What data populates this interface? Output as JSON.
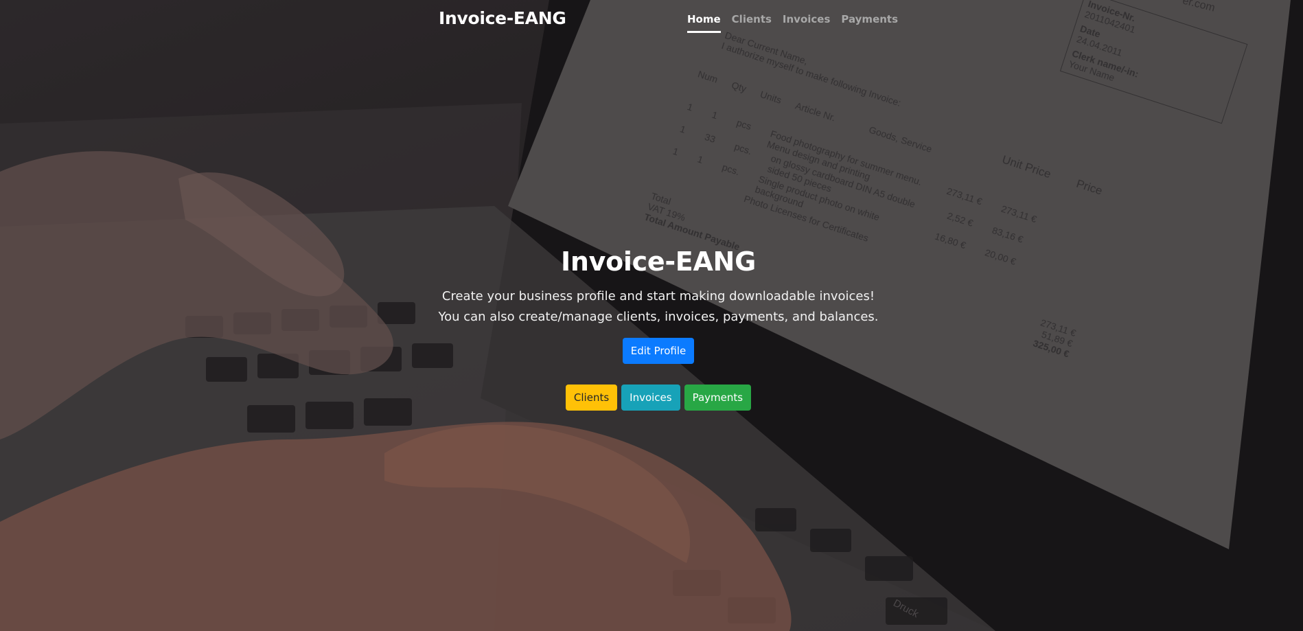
{
  "navbar": {
    "brand": "Invoice-EANG",
    "links": [
      {
        "label": "Home",
        "active": true
      },
      {
        "label": "Clients",
        "active": false
      },
      {
        "label": "Invoices",
        "active": false
      },
      {
        "label": "Payments",
        "active": false
      }
    ]
  },
  "hero": {
    "title": "Invoice-EANG",
    "line1": "Create your business profile and start making downloadable invoices!",
    "line2": "You can also create/manage clients, invoices, payments, and balances.",
    "edit_profile_label": "Edit Profile",
    "quick_links": {
      "clients_label": "Clients",
      "invoices_label": "Invoices",
      "payments_label": "Payments"
    }
  },
  "background_invoice": {
    "corner_text": "er.com",
    "header_lines": [
      "Dear Current Name,",
      "I authorize myself to make following Invoice:"
    ],
    "meta": [
      {
        "label": "Invoice-Nr.",
        "value": "2011042401"
      },
      {
        "label": "Date",
        "value": "24.04.2011"
      },
      {
        "label": "Clerk name/-in:",
        "value": "Your Name"
      }
    ],
    "columns": [
      "Num",
      "Qty",
      "Units",
      "Article Nr.",
      "Goods, Service",
      "Unit Price",
      "Price"
    ],
    "rows": [
      [
        "1",
        "1",
        "pcs",
        "Food photography for summer menu. Menu design and printing",
        "273,11 €",
        "273,11 €"
      ],
      [
        "1",
        "33",
        "pcs.",
        "on glossy cardboard DIN A5 double sided 50 pieces",
        "2,52 €",
        "83,16 €"
      ],
      [
        "1",
        "1",
        "pcs.",
        "Single product photo on white background",
        "16,80 €",
        "20,00 €"
      ],
      [
        "",
        "",
        "",
        "Photo Licenses for Certificates",
        "",
        ""
      ]
    ],
    "totals": [
      {
        "label": "Total",
        "value": "273,11 €"
      },
      {
        "label": "VAT 19%",
        "value": "51,89 €"
      },
      {
        "label": "Total Amount Payable",
        "value": "325,00 €"
      }
    ],
    "key_label": "Druck"
  },
  "colors": {
    "primary": "#0b7bff",
    "warning": "#ffc107",
    "info": "#17a2b8",
    "success": "#28a745"
  }
}
